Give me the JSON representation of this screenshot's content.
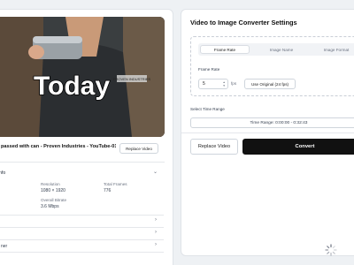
{
  "video": {
    "overlay_text": "Today",
    "shirt_text": "PROVEN INDUSTRIES",
    "file_name": "passed with can - Proven Industries - YouTube-01...",
    "replace_label": "Replace Video"
  },
  "info": {
    "heading": "nfo",
    "resolution_label": "Resolution",
    "resolution_value": "1080 × 1920",
    "frames_label": "Total Frames",
    "frames_value": "776",
    "bitrate_label": "Overall Bitrate",
    "bitrate_value": "3.6 Mbps",
    "last_row_label": "ner"
  },
  "settings": {
    "title": "Video to Image Converter Settings",
    "tabs": [
      "Frame Rate",
      "Image Name",
      "Image Format"
    ],
    "frame_rate_label": "Frame Rate",
    "frame_rate_value": "5",
    "fps_unit": "fps",
    "use_original_label": "Use Original (24 fps)",
    "time_range_label": "Select Time Range",
    "time_range_value": "Time Range: 0:00:00 - 0:32:43",
    "replace_button": "Replace Video",
    "convert_button": "Convert"
  },
  "colors": {
    "convert_bg": "#111111",
    "video_bg": "#2f3234"
  },
  "icons": [
    "chevron-down-icon",
    "chevron-right-icon",
    "spinner-icon"
  ]
}
